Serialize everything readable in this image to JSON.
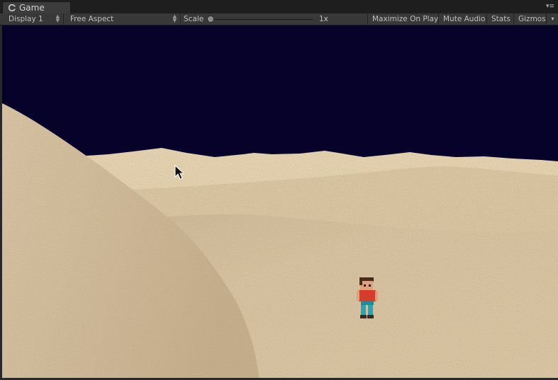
{
  "window": {
    "tab_title": "Game",
    "tab_icon": "unity-icon"
  },
  "toolbar": {
    "display": "Display 1",
    "aspect": "Free Aspect",
    "scale_label": "Scale",
    "scale_value": "1x",
    "maximize_on_play": "Maximize On Play",
    "mute_audio": "Mute Audio",
    "stats": "Stats",
    "gizmos": "Gizmos"
  },
  "scene": {
    "sky_color": "#07022a",
    "sand_color": "#dcc9a6",
    "entities": [
      "sand-dune",
      "player-character",
      "mouse-cursor"
    ]
  }
}
